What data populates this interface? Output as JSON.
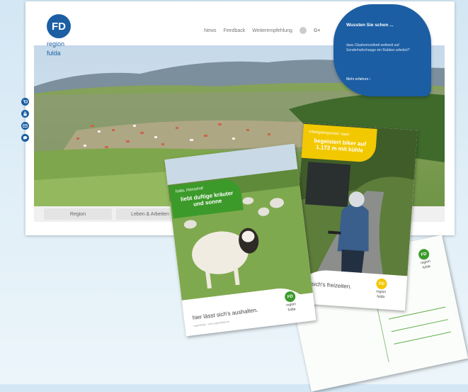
{
  "website": {
    "logo": {
      "badge": "FD",
      "line1": "region",
      "line2": "fulda"
    },
    "topnav": {
      "item1": "News",
      "item2": "Feedback",
      "item3": "Weiterempfehlung",
      "social": "G+"
    },
    "bottomnav": {
      "tab1": "Region",
      "tab2": "Leben & Arbeiten"
    },
    "side_icons": [
      "cart-icon",
      "lock-icon",
      "mail-icon",
      "chat-icon"
    ],
    "bubble": {
      "title": "Wussten Sie schon ...",
      "body": "dass Glasbomontbett weltweit auf Sonderhafschauge ein Rabbes arbeitet?",
      "link": "Mehr erfahren ›"
    }
  },
  "sheep_flyer": {
    "tag_small": "fulda, rhönschaf",
    "tag_big": "liebt duftige kräuter und sonne",
    "slogan": "hier lässt sich's aushalten.",
    "fineprint": "regionfulda · www.regionfulda.de",
    "logo": {
      "badge": "FD",
      "line1": "region",
      "line2": "fulda"
    }
  },
  "biker_flyer": {
    "tag_small": "mittelgebirgsmed. naan",
    "tag_big": "begeistert biker auf 1.172 m mit kühle",
    "slogan": "lässt sich's freizeiten.",
    "logo": {
      "badge": "FD",
      "line1": "region",
      "line2": "fulda"
    }
  },
  "postcard": {
    "logo": {
      "badge": "FD",
      "line1": "region",
      "line2": "fulda"
    }
  },
  "colors": {
    "brand_blue": "#1b5ea3",
    "green": "#3c9a2a",
    "yellow": "#f2c800",
    "background": "#d3e7f4"
  }
}
